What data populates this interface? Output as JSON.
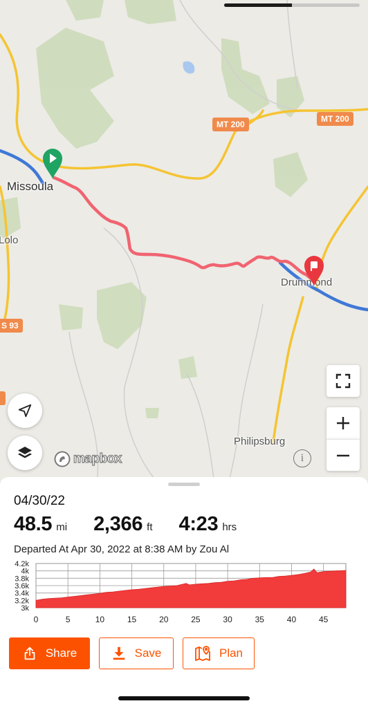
{
  "status_bar": {
    "progress": 0.5
  },
  "map": {
    "labels": {
      "missoula": "Missoula",
      "lolo": "Lolo",
      "drummond": "Drummond",
      "philipsburg": "Philipsburg"
    },
    "shields": {
      "mt200_a": "MT 200",
      "mt200_b": "MT 200",
      "us93": "S 93"
    },
    "attribution": "mapbox",
    "colors": {
      "route": "#f06470",
      "start_pin": "#1fa463",
      "end_pin": "#e8373e",
      "water": "#3f78d6",
      "road": "#f5c432",
      "forest": "#cfdcbc"
    },
    "icons": [
      "navigation-arrow-icon",
      "layers-icon",
      "fullscreen-icon",
      "zoom-in-icon",
      "zoom-out-icon",
      "info-icon"
    ]
  },
  "activity": {
    "date": "04/30/22",
    "distance": {
      "value": "48.5",
      "unit": "mi"
    },
    "elevation": {
      "value": "2,366",
      "unit": "ft"
    },
    "time": {
      "value": "4:23",
      "unit": "hrs"
    },
    "departed": "Departed At Apr 30, 2022 at 8:38 AM by Zou Al"
  },
  "chart_data": {
    "type": "area",
    "title": "",
    "xlabel": "",
    "ylabel": "",
    "x_ticks": [
      "0",
      "5",
      "10",
      "15",
      "20",
      "25",
      "30",
      "35",
      "40",
      "45"
    ],
    "y_ticks": [
      "3k",
      "3.2k",
      "3.4k",
      "3.6k",
      "3.8k",
      "4k",
      "4.2k"
    ],
    "xlim": [
      0,
      48.5
    ],
    "ylim": [
      3000,
      4200
    ],
    "grid": true,
    "color": "#f23b3b",
    "series": [
      {
        "x": [
          0,
          1,
          2,
          3,
          4,
          5,
          6,
          7,
          8,
          9,
          10,
          11,
          12,
          13,
          14,
          15,
          16,
          17,
          18,
          19,
          20,
          21,
          22,
          23,
          23.5,
          24,
          25,
          26,
          27,
          28,
          29,
          30,
          31,
          32,
          33,
          34,
          35,
          36,
          37,
          38,
          39,
          40,
          41,
          42,
          43,
          43.5,
          44,
          45,
          46,
          47,
          48.5
        ],
        "y": [
          3200,
          3230,
          3250,
          3260,
          3270,
          3290,
          3310,
          3330,
          3350,
          3370,
          3390,
          3420,
          3430,
          3450,
          3470,
          3490,
          3500,
          3520,
          3540,
          3560,
          3580,
          3590,
          3600,
          3640,
          3660,
          3620,
          3640,
          3650,
          3660,
          3680,
          3690,
          3720,
          3730,
          3760,
          3770,
          3800,
          3810,
          3820,
          3820,
          3850,
          3860,
          3880,
          3900,
          3930,
          3970,
          4050,
          3950,
          3980,
          3990,
          4000,
          4010
        ]
      }
    ]
  },
  "actions": {
    "share": "Share",
    "save": "Save",
    "plan": "Plan"
  }
}
